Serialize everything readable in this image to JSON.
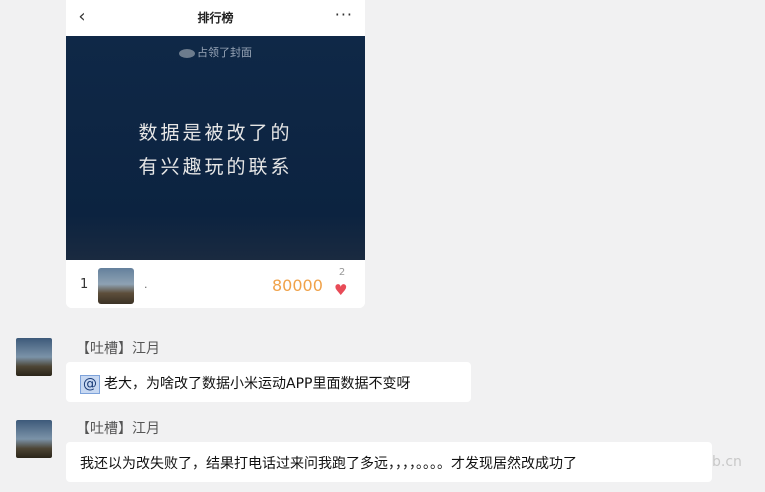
{
  "card": {
    "back_icon": "chevron-left-icon",
    "title": "排行榜",
    "more_icon": "more-icon",
    "more_glyph": "···",
    "occupied_text": "占领了封面",
    "cover_line1": "数据是被改了的",
    "cover_line2": "有兴趣玩的联系",
    "rank": {
      "position": "1",
      "name": ".",
      "score": "80000",
      "likes": "2",
      "heart_icon": "heart-icon",
      "score_color": "#f0a24a",
      "heart_color": "#e84b57"
    }
  },
  "messages": [
    {
      "sender": "【吐槽】江月",
      "mention": "@",
      "text": "老大，为啥改了数据小米运动APP里面数据不变呀"
    },
    {
      "sender": "【吐槽】江月",
      "text": "我还以为改失败了，结果打电话过来问我跑了多远，，，，。。。。才发现居然改成功了"
    }
  ],
  "watermark": "b.cn"
}
